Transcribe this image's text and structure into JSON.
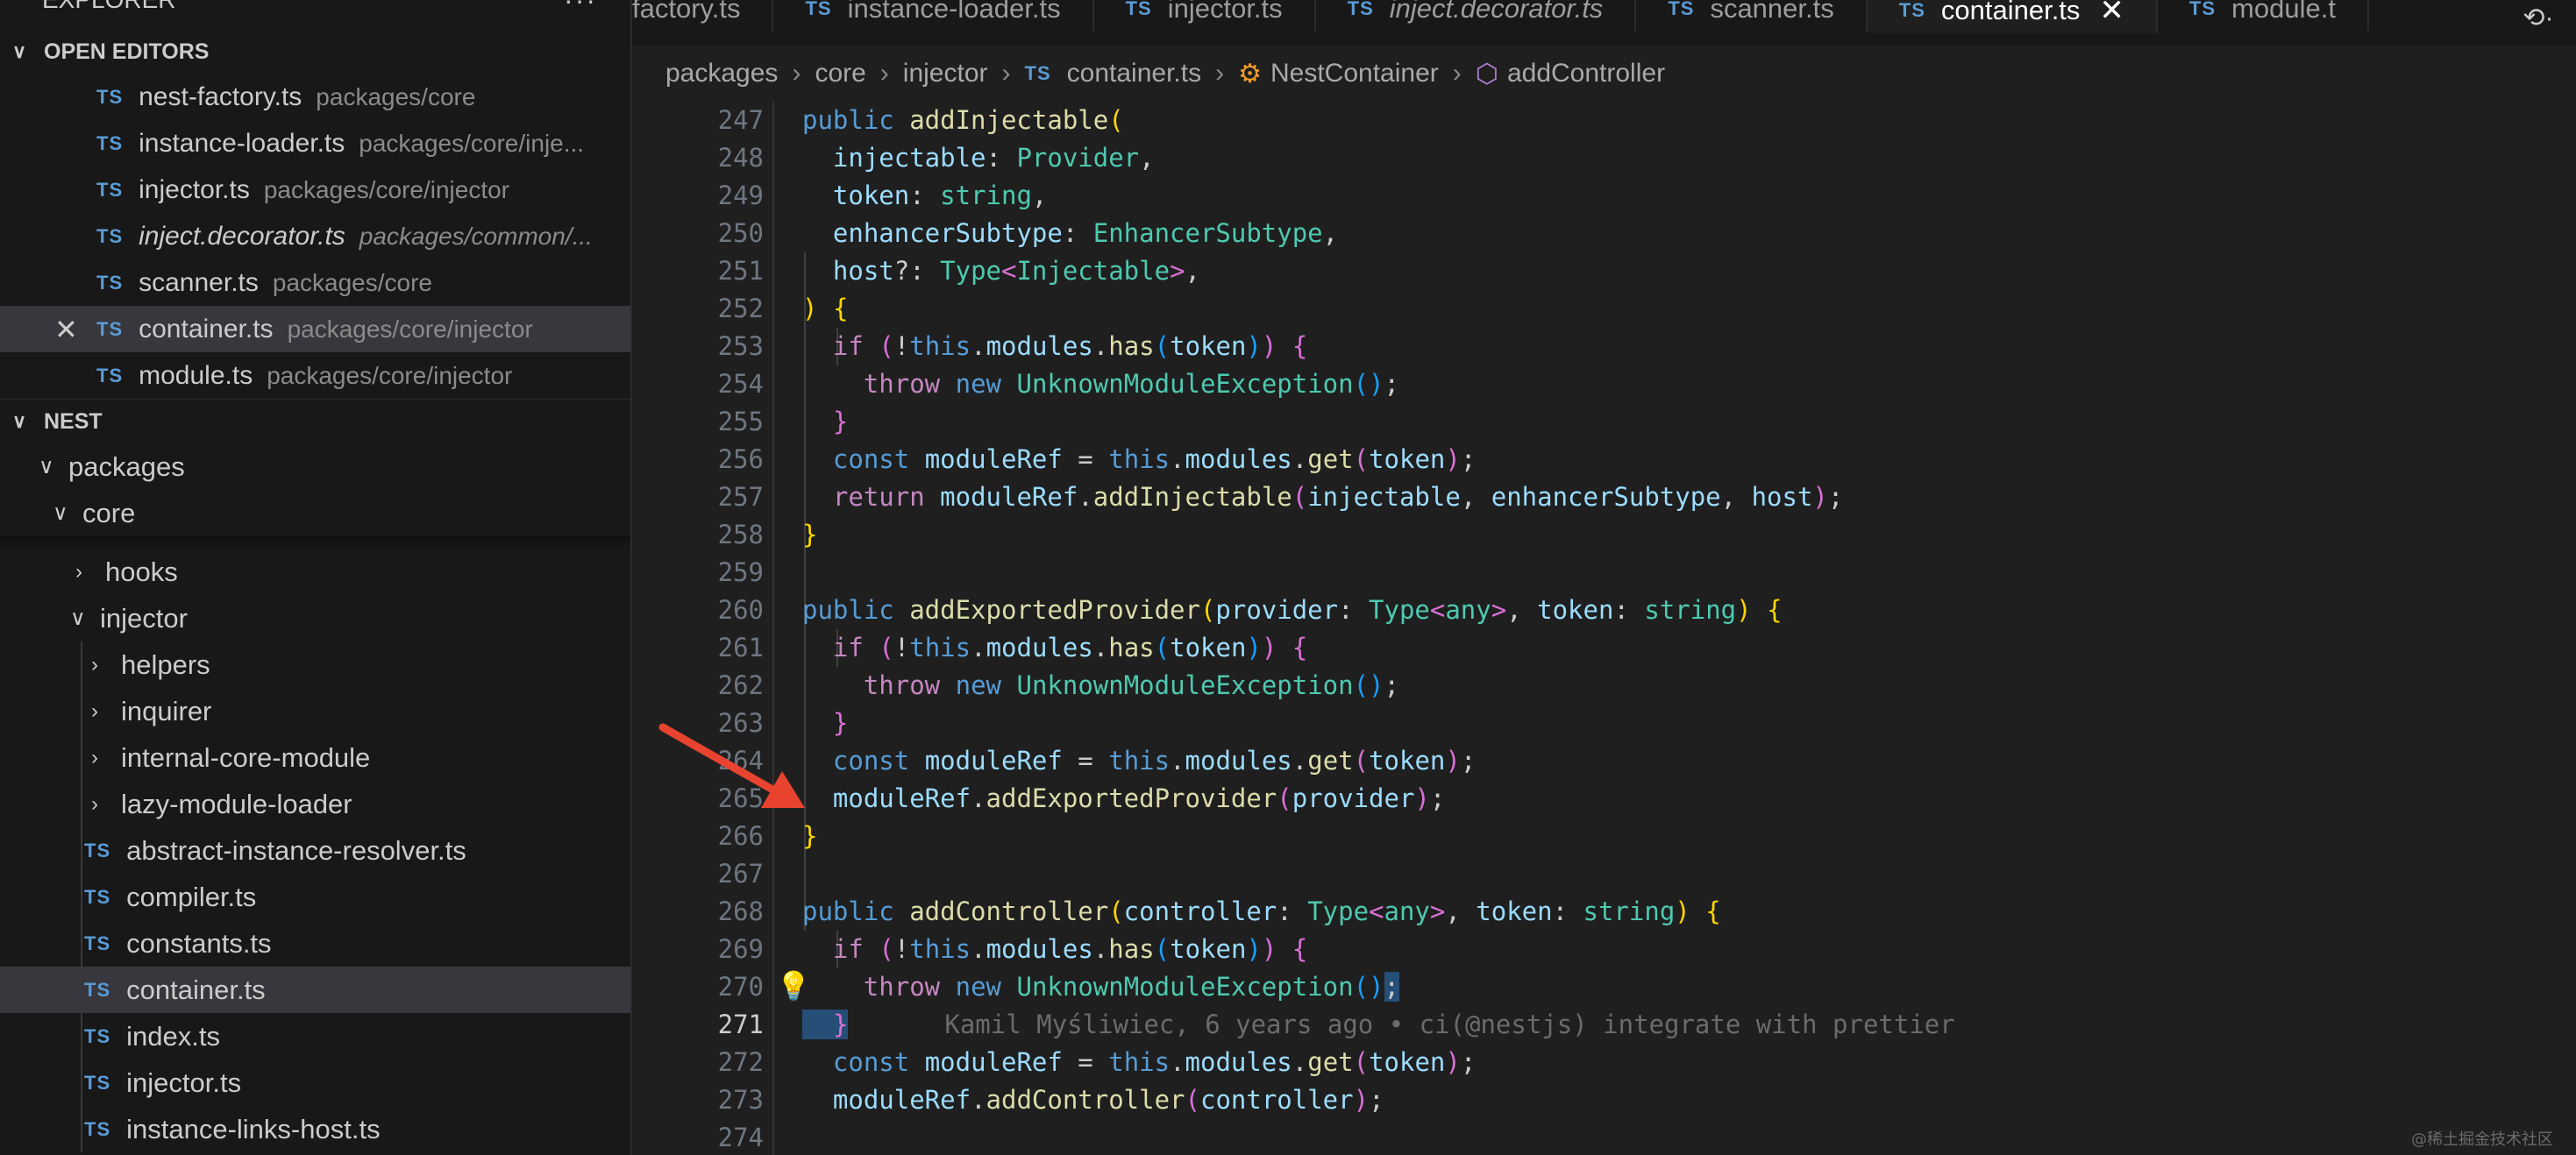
{
  "explorer": {
    "title": "EXPLORER",
    "more": "···",
    "open_editors_title": "OPEN EDITORS",
    "open_editors": [
      {
        "badge": "TS",
        "name": "nest-factory.ts",
        "path": "packages/core"
      },
      {
        "badge": "TS",
        "name": "instance-loader.ts",
        "path": "packages/core/inje..."
      },
      {
        "badge": "TS",
        "name": "injector.ts",
        "path": "packages/core/injector"
      },
      {
        "badge": "TS",
        "name": "inject.decorator.ts",
        "path": "packages/common/..."
      },
      {
        "badge": "TS",
        "name": "scanner.ts",
        "path": "packages/core"
      },
      {
        "badge": "TS",
        "name": "container.ts",
        "path": "packages/core/injector"
      },
      {
        "badge": "TS",
        "name": "module.ts",
        "path": "packages/core/injector"
      }
    ],
    "close_glyph": "✕",
    "workspace_title": "NEST",
    "tree": {
      "packages": "packages",
      "core": "core",
      "hooks": "hooks",
      "injector": "injector",
      "helpers": "helpers",
      "inquirer": "inquirer",
      "internal_core_module": "internal-core-module",
      "lazy_module_loader": "lazy-module-loader",
      "files": [
        {
          "badge": "TS",
          "name": "abstract-instance-resolver.ts"
        },
        {
          "badge": "TS",
          "name": "compiler.ts"
        },
        {
          "badge": "TS",
          "name": "constants.ts"
        },
        {
          "badge": "TS",
          "name": "container.ts"
        },
        {
          "badge": "TS",
          "name": "index.ts"
        },
        {
          "badge": "TS",
          "name": "injector.ts"
        },
        {
          "badge": "TS",
          "name": "instance-links-host.ts"
        }
      ]
    }
  },
  "tabs": [
    {
      "badge": "",
      "name": "factory.ts"
    },
    {
      "badge": "TS",
      "name": "instance-loader.ts"
    },
    {
      "badge": "TS",
      "name": "injector.ts"
    },
    {
      "badge": "TS",
      "name": "inject.decorator.ts"
    },
    {
      "badge": "TS",
      "name": "scanner.ts"
    },
    {
      "badge": "TS",
      "name": "container.ts"
    },
    {
      "badge": "TS",
      "name": "module.t"
    }
  ],
  "tab_close_glyph": "✕",
  "tab_tools_glyph": "⟲·",
  "breadcrumb": {
    "packages": "packages",
    "core": "core",
    "injector": "injector",
    "file_badge": "TS",
    "file": "container.ts",
    "class": "NestContainer",
    "method": "addController",
    "sep": "›"
  },
  "editor": {
    "blame": "Kamil Myśliwiec, 6 years ago • ci(@nestjs) integrate with prettier",
    "lines": [
      {
        "n": "247",
        "segs": [
          [
            "k",
            "public "
          ],
          [
            "f",
            "addInjectable"
          ],
          [
            "b1",
            "("
          ]
        ]
      },
      {
        "n": "248",
        "segs": [
          [
            "p",
            "  "
          ],
          [
            "v",
            "injectable"
          ],
          [
            "p",
            ": "
          ],
          [
            "t",
            "Provider"
          ],
          [
            "p",
            ","
          ]
        ]
      },
      {
        "n": "249",
        "segs": [
          [
            "p",
            "  "
          ],
          [
            "v",
            "token"
          ],
          [
            "p",
            ": "
          ],
          [
            "t",
            "string"
          ],
          [
            "p",
            ","
          ]
        ]
      },
      {
        "n": "250",
        "segs": [
          [
            "p",
            "  "
          ],
          [
            "v",
            "enhancerSubtype"
          ],
          [
            "p",
            ": "
          ],
          [
            "t",
            "EnhancerSubtype"
          ],
          [
            "p",
            ","
          ]
        ]
      },
      {
        "n": "251",
        "segs": [
          [
            "p",
            "  "
          ],
          [
            "v",
            "host"
          ],
          [
            "p",
            "?: "
          ],
          [
            "t",
            "Type"
          ],
          [
            "b2",
            "<"
          ],
          [
            "t",
            "Injectable"
          ],
          [
            "b2",
            ">"
          ],
          [
            "p",
            ","
          ]
        ]
      },
      {
        "n": "252",
        "segs": [
          [
            "b1",
            ")"
          ],
          [
            "p",
            " "
          ],
          [
            "b1",
            "{"
          ]
        ]
      },
      {
        "n": "253",
        "segs": [
          [
            "p",
            "  "
          ],
          [
            "c",
            "if"
          ],
          [
            "p",
            " "
          ],
          [
            "b2",
            "("
          ],
          [
            "p",
            "!"
          ],
          [
            "k",
            "this"
          ],
          [
            "p",
            "."
          ],
          [
            "v",
            "modules"
          ],
          [
            "p",
            "."
          ],
          [
            "f",
            "has"
          ],
          [
            "b3",
            "("
          ],
          [
            "v",
            "token"
          ],
          [
            "b3",
            ")"
          ],
          [
            "b2",
            ")"
          ],
          [
            "p",
            " "
          ],
          [
            "b2",
            "{"
          ]
        ]
      },
      {
        "n": "254",
        "segs": [
          [
            "p",
            "    "
          ],
          [
            "c",
            "throw"
          ],
          [
            "p",
            " "
          ],
          [
            "k",
            "new"
          ],
          [
            "p",
            " "
          ],
          [
            "t",
            "UnknownModuleException"
          ],
          [
            "b3",
            "()"
          ],
          [
            "p",
            ";"
          ]
        ]
      },
      {
        "n": "255",
        "segs": [
          [
            "p",
            "  "
          ],
          [
            "b2",
            "}"
          ]
        ]
      },
      {
        "n": "256",
        "segs": [
          [
            "p",
            "  "
          ],
          [
            "k",
            "const"
          ],
          [
            "p",
            " "
          ],
          [
            "v",
            "moduleRef"
          ],
          [
            "p",
            " = "
          ],
          [
            "k",
            "this"
          ],
          [
            "p",
            "."
          ],
          [
            "v",
            "modules"
          ],
          [
            "p",
            "."
          ],
          [
            "f",
            "get"
          ],
          [
            "b2",
            "("
          ],
          [
            "v",
            "token"
          ],
          [
            "b2",
            ")"
          ],
          [
            "p",
            ";"
          ]
        ]
      },
      {
        "n": "257",
        "segs": [
          [
            "p",
            "  "
          ],
          [
            "c",
            "return"
          ],
          [
            "p",
            " "
          ],
          [
            "v",
            "moduleRef"
          ],
          [
            "p",
            "."
          ],
          [
            "f",
            "addInjectable"
          ],
          [
            "b2",
            "("
          ],
          [
            "v",
            "injectable"
          ],
          [
            "p",
            ", "
          ],
          [
            "v",
            "enhancerSubtype"
          ],
          [
            "p",
            ", "
          ],
          [
            "v",
            "host"
          ],
          [
            "b2",
            ")"
          ],
          [
            "p",
            ";"
          ]
        ]
      },
      {
        "n": "258",
        "segs": [
          [
            "b1",
            "}"
          ]
        ]
      },
      {
        "n": "259",
        "segs": []
      },
      {
        "n": "260",
        "segs": [
          [
            "k",
            "public "
          ],
          [
            "f",
            "addExportedProvider"
          ],
          [
            "b1",
            "("
          ],
          [
            "v",
            "provider"
          ],
          [
            "p",
            ": "
          ],
          [
            "t",
            "Type"
          ],
          [
            "b2",
            "<"
          ],
          [
            "t",
            "any"
          ],
          [
            "b2",
            ">"
          ],
          [
            "p",
            ", "
          ],
          [
            "v",
            "token"
          ],
          [
            "p",
            ": "
          ],
          [
            "t",
            "string"
          ],
          [
            "b1",
            ")"
          ],
          [
            "p",
            " "
          ],
          [
            "b1",
            "{"
          ]
        ]
      },
      {
        "n": "261",
        "segs": [
          [
            "p",
            "  "
          ],
          [
            "c",
            "if"
          ],
          [
            "p",
            " "
          ],
          [
            "b2",
            "("
          ],
          [
            "p",
            "!"
          ],
          [
            "k",
            "this"
          ],
          [
            "p",
            "."
          ],
          [
            "v",
            "modules"
          ],
          [
            "p",
            "."
          ],
          [
            "f",
            "has"
          ],
          [
            "b3",
            "("
          ],
          [
            "v",
            "token"
          ],
          [
            "b3",
            ")"
          ],
          [
            "b2",
            ")"
          ],
          [
            "p",
            " "
          ],
          [
            "b2",
            "{"
          ]
        ]
      },
      {
        "n": "262",
        "segs": [
          [
            "p",
            "    "
          ],
          [
            "c",
            "throw"
          ],
          [
            "p",
            " "
          ],
          [
            "k",
            "new"
          ],
          [
            "p",
            " "
          ],
          [
            "t",
            "UnknownModuleException"
          ],
          [
            "b3",
            "()"
          ],
          [
            "p",
            ";"
          ]
        ]
      },
      {
        "n": "263",
        "segs": [
          [
            "p",
            "  "
          ],
          [
            "b2",
            "}"
          ]
        ]
      },
      {
        "n": "264",
        "segs": [
          [
            "p",
            "  "
          ],
          [
            "k",
            "const"
          ],
          [
            "p",
            " "
          ],
          [
            "v",
            "moduleRef"
          ],
          [
            "p",
            " = "
          ],
          [
            "k",
            "this"
          ],
          [
            "p",
            "."
          ],
          [
            "v",
            "modules"
          ],
          [
            "p",
            "."
          ],
          [
            "f",
            "get"
          ],
          [
            "b2",
            "("
          ],
          [
            "v",
            "token"
          ],
          [
            "b2",
            ")"
          ],
          [
            "p",
            ";"
          ]
        ]
      },
      {
        "n": "265",
        "segs": [
          [
            "p",
            "  "
          ],
          [
            "v",
            "moduleRef"
          ],
          [
            "p",
            "."
          ],
          [
            "f",
            "addExportedProvider"
          ],
          [
            "b2",
            "("
          ],
          [
            "v",
            "provider"
          ],
          [
            "b2",
            ")"
          ],
          [
            "p",
            ";"
          ]
        ]
      },
      {
        "n": "266",
        "segs": [
          [
            "b1",
            "}"
          ]
        ]
      },
      {
        "n": "267",
        "segs": []
      },
      {
        "n": "268",
        "segs": [
          [
            "k",
            "public "
          ],
          [
            "f",
            "addController"
          ],
          [
            "b1",
            "("
          ],
          [
            "v",
            "controller"
          ],
          [
            "p",
            ": "
          ],
          [
            "t",
            "Type"
          ],
          [
            "b2",
            "<"
          ],
          [
            "t",
            "any"
          ],
          [
            "b2",
            ">"
          ],
          [
            "p",
            ", "
          ],
          [
            "v",
            "token"
          ],
          [
            "p",
            ": "
          ],
          [
            "t",
            "string"
          ],
          [
            "b1",
            ")"
          ],
          [
            "p",
            " "
          ],
          [
            "b1",
            "{"
          ]
        ]
      },
      {
        "n": "269",
        "segs": [
          [
            "p",
            "  "
          ],
          [
            "c",
            "if"
          ],
          [
            "p",
            " "
          ],
          [
            "b2",
            "("
          ],
          [
            "p",
            "!"
          ],
          [
            "k",
            "this"
          ],
          [
            "p",
            "."
          ],
          [
            "v",
            "modules"
          ],
          [
            "p",
            "."
          ],
          [
            "f",
            "has"
          ],
          [
            "b3",
            "("
          ],
          [
            "v",
            "token"
          ],
          [
            "b3",
            ")"
          ],
          [
            "b2",
            ")"
          ],
          [
            "p",
            " "
          ],
          [
            "b2",
            "{"
          ]
        ]
      },
      {
        "n": "270",
        "segs": [
          [
            "p",
            "    "
          ],
          [
            "c",
            "throw"
          ],
          [
            "p",
            " "
          ],
          [
            "k",
            "new"
          ],
          [
            "p",
            " "
          ],
          [
            "t",
            "UnknownModuleException"
          ],
          [
            "b3",
            "()"
          ],
          [
            "p",
            ";"
          ]
        ]
      },
      {
        "n": "271",
        "segs": [
          [
            "p",
            "  "
          ],
          [
            "b2",
            "}"
          ]
        ]
      },
      {
        "n": "272",
        "segs": [
          [
            "p",
            "  "
          ],
          [
            "k",
            "const"
          ],
          [
            "p",
            " "
          ],
          [
            "v",
            "moduleRef"
          ],
          [
            "p",
            " = "
          ],
          [
            "k",
            "this"
          ],
          [
            "p",
            "."
          ],
          [
            "v",
            "modules"
          ],
          [
            "p",
            "."
          ],
          [
            "f",
            "get"
          ],
          [
            "b2",
            "("
          ],
          [
            "v",
            "token"
          ],
          [
            "b2",
            ")"
          ],
          [
            "p",
            ";"
          ]
        ]
      },
      {
        "n": "273",
        "segs": [
          [
            "p",
            "  "
          ],
          [
            "v",
            "moduleRef"
          ],
          [
            "p",
            "."
          ],
          [
            "f",
            "addController"
          ],
          [
            "b2",
            "("
          ],
          [
            "v",
            "controller"
          ],
          [
            "b2",
            ")"
          ],
          [
            "p",
            ";"
          ]
        ]
      },
      {
        "n": "274",
        "segs": []
      }
    ]
  },
  "lightbulb": "💡",
  "colors": {
    "accent": "#0078d4",
    "arrow": "#e8432f",
    "ts_badge": "#5a9bd5"
  },
  "watermark": "@稀土掘金技术社区"
}
